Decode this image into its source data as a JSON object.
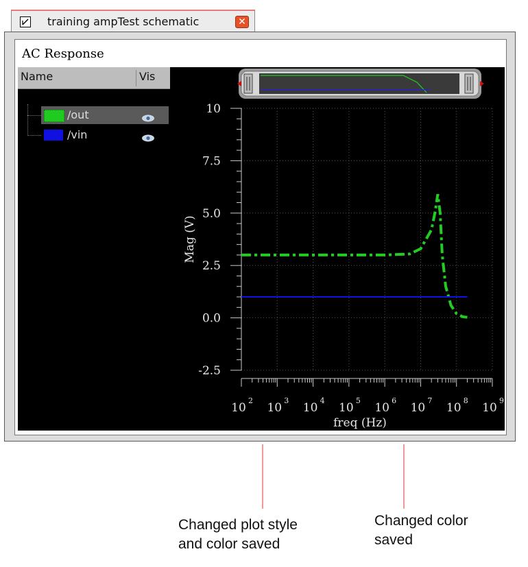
{
  "window": {
    "tab_title": "training ampTest schematic",
    "close_glyph": "✕",
    "panel_title": "AC Response"
  },
  "tree": {
    "columns": {
      "name": "Name",
      "vis": "Vis"
    },
    "items": [
      {
        "label": "/out",
        "color": "#1ecb1e",
        "selected": true
      },
      {
        "label": "/vin",
        "color": "#1010e0",
        "selected": false
      }
    ]
  },
  "chart_data": {
    "type": "line",
    "xlabel": "freq (Hz)",
    "ylabel": "Mag (V)",
    "xscale": "log",
    "xlim": [
      100,
      1000000000
    ],
    "ylim": [
      -2.5,
      10
    ],
    "yticks": [
      "10",
      "7.5",
      "5.0",
      "2.5",
      "0.0",
      "-2.5"
    ],
    "xticks": [
      {
        "base": "10",
        "exp": "2"
      },
      {
        "base": "10",
        "exp": "3"
      },
      {
        "base": "10",
        "exp": "4"
      },
      {
        "base": "10",
        "exp": "5"
      },
      {
        "base": "10",
        "exp": "6"
      },
      {
        "base": "10",
        "exp": "7"
      },
      {
        "base": "10",
        "exp": "8"
      },
      {
        "base": "10",
        "exp": "9"
      }
    ],
    "grid": true,
    "series": [
      {
        "name": "/out",
        "color": "#22cc22",
        "style": "dash-dot",
        "x": [
          100,
          1000,
          10000,
          100000,
          1000000,
          5000000,
          10000000,
          20000000,
          25000000,
          30000000,
          35000000,
          40000000,
          50000000,
          70000000,
          100000000,
          150000000,
          200000000
        ],
        "y": [
          3.0,
          3.0,
          3.0,
          3.0,
          3.0,
          3.05,
          3.3,
          4.2,
          5.0,
          5.9,
          5.0,
          3.0,
          1.5,
          0.6,
          0.2,
          0.05,
          0.03
        ]
      },
      {
        "name": "/vin",
        "color": "#1010e6",
        "style": "solid",
        "x": [
          100,
          200000000
        ],
        "y": [
          1.0,
          1.0
        ]
      }
    ]
  },
  "annotations": [
    {
      "line1": "Changed plot style",
      "line2": "and color saved",
      "color": "#e03030"
    },
    {
      "line1": "Changed color",
      "line2": "saved",
      "color": "#e03030"
    }
  ]
}
